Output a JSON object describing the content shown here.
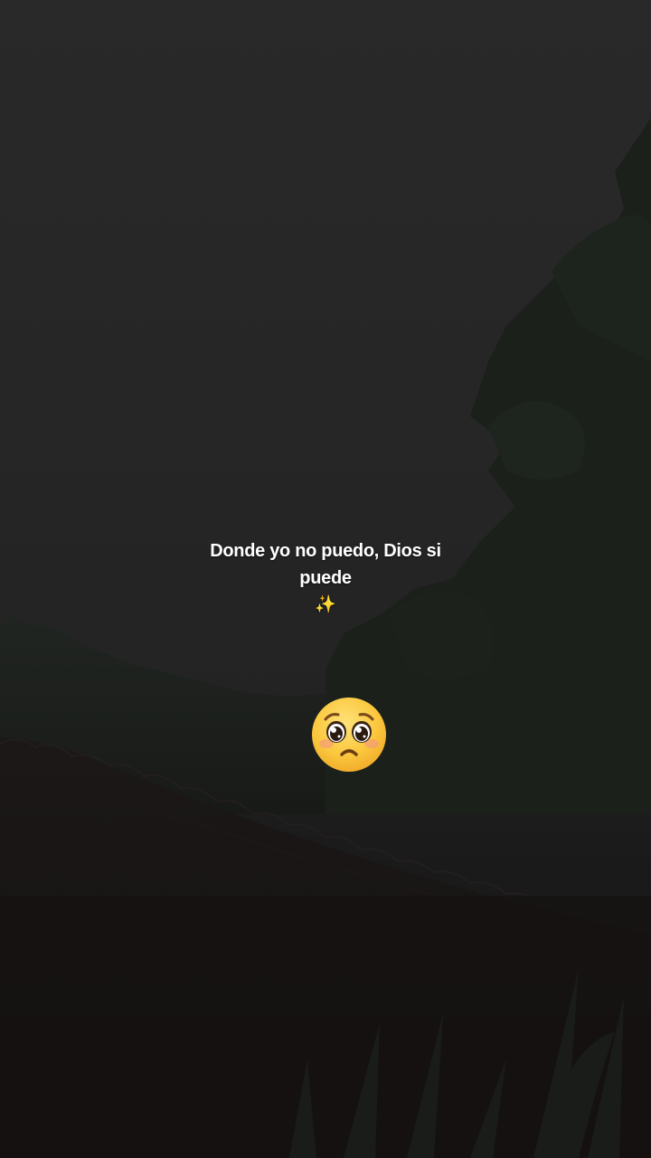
{
  "caption": {
    "line1": "Donde yo no puedo, Dios si",
    "line2": "puede",
    "sparkle": "✨"
  },
  "emoji": {
    "icon": "pleading-face-emoji"
  },
  "colors": {
    "sky": "#262626",
    "hills": "#1e221e",
    "foliage": "#1a1f1a",
    "roof": "#161313",
    "text": "#ffffff",
    "emoji_face": "#f7c244"
  }
}
